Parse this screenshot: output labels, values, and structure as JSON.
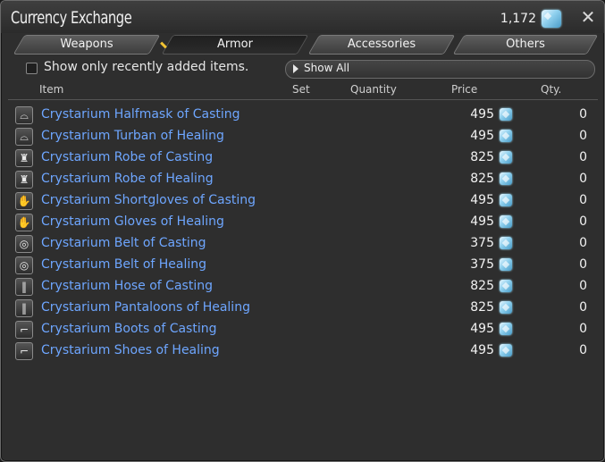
{
  "window": {
    "title": "Currency Exchange",
    "currency_amount": "1,172",
    "currency_icon": "allagan-tomestone-icon",
    "close_icon": "close-icon"
  },
  "tabs": [
    {
      "label": "Weapons",
      "active": false
    },
    {
      "label": "Armor",
      "active": true
    },
    {
      "label": "Accessories",
      "active": false
    },
    {
      "label": "Others",
      "active": false
    }
  ],
  "filter": {
    "checkbox_label": "Show only recently added items.",
    "checked": false
  },
  "dropdown": {
    "selected": "Show All"
  },
  "columns": {
    "item": "Item",
    "set": "Set",
    "quantity": "Quantity",
    "price": "Price",
    "qty": "Qty."
  },
  "items": [
    {
      "name": "Crystarium Halfmask of Casting",
      "icon": "head-gear-icon",
      "price": "495",
      "qty": "0"
    },
    {
      "name": "Crystarium Turban of Healing",
      "icon": "head-gear-icon",
      "price": "495",
      "qty": "0"
    },
    {
      "name": "Crystarium Robe of Casting",
      "icon": "body-armor-icon",
      "price": "825",
      "qty": "0"
    },
    {
      "name": "Crystarium Robe of Healing",
      "icon": "body-armor-icon",
      "price": "825",
      "qty": "0"
    },
    {
      "name": "Crystarium Shortgloves of Casting",
      "icon": "gloves-icon",
      "price": "495",
      "qty": "0"
    },
    {
      "name": "Crystarium Gloves of Healing",
      "icon": "gloves-icon",
      "price": "495",
      "qty": "0"
    },
    {
      "name": "Crystarium Belt of Casting",
      "icon": "belt-icon",
      "price": "375",
      "qty": "0"
    },
    {
      "name": "Crystarium Belt of Healing",
      "icon": "belt-icon",
      "price": "375",
      "qty": "0"
    },
    {
      "name": "Crystarium Hose of Casting",
      "icon": "legs-icon",
      "price": "825",
      "qty": "0"
    },
    {
      "name": "Crystarium Pantaloons of Healing",
      "icon": "legs-icon",
      "price": "825",
      "qty": "0"
    },
    {
      "name": "Crystarium Boots of Casting",
      "icon": "feet-icon",
      "price": "495",
      "qty": "0"
    },
    {
      "name": "Crystarium Shoes of Healing",
      "icon": "feet-icon",
      "price": "495",
      "qty": "0"
    }
  ],
  "colors": {
    "item_link": "#6ea6ff",
    "window_bg": "#2e2e2e",
    "active_tab_marker": "#f1c232"
  }
}
